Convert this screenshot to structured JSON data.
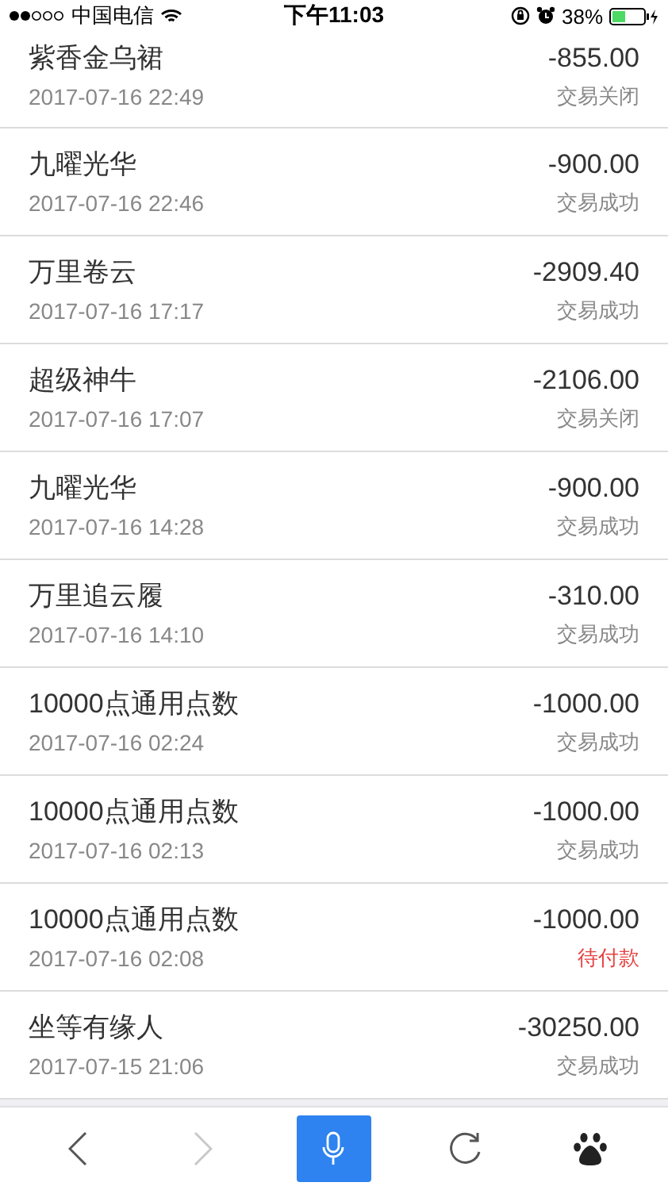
{
  "status_bar": {
    "carrier": "中国电信",
    "time": "下午11:03",
    "battery": "38%"
  },
  "orders": [
    {
      "title": "紫香金乌裙",
      "date": "2017-07-16 22:49",
      "amount": "-855.00",
      "status": "交易关闭",
      "pending": false
    },
    {
      "title": "九曜光华",
      "date": "2017-07-16 22:46",
      "amount": "-900.00",
      "status": "交易成功",
      "pending": false
    },
    {
      "title": "万里卷云",
      "date": "2017-07-16 17:17",
      "amount": "-2909.40",
      "status": "交易成功",
      "pending": false
    },
    {
      "title": "超级神牛",
      "date": "2017-07-16 17:07",
      "amount": "-2106.00",
      "status": "交易关闭",
      "pending": false
    },
    {
      "title": "九曜光华",
      "date": "2017-07-16 14:28",
      "amount": "-900.00",
      "status": "交易成功",
      "pending": false
    },
    {
      "title": "万里追云履",
      "date": "2017-07-16 14:10",
      "amount": "-310.00",
      "status": "交易成功",
      "pending": false
    },
    {
      "title": "10000点通用点数",
      "date": "2017-07-16 02:24",
      "amount": "-1000.00",
      "status": "交易成功",
      "pending": false
    },
    {
      "title": "10000点通用点数",
      "date": "2017-07-16 02:13",
      "amount": "-1000.00",
      "status": "交易成功",
      "pending": false
    },
    {
      "title": "10000点通用点数",
      "date": "2017-07-16 02:08",
      "amount": "-1000.00",
      "status": "待付款",
      "pending": true
    },
    {
      "title": "坐等有缘人",
      "date": "2017-07-15 21:06",
      "amount": "-30250.00",
      "status": "交易成功",
      "pending": false
    }
  ],
  "toolbar": {
    "back_disabled": false,
    "forward_disabled": true
  }
}
